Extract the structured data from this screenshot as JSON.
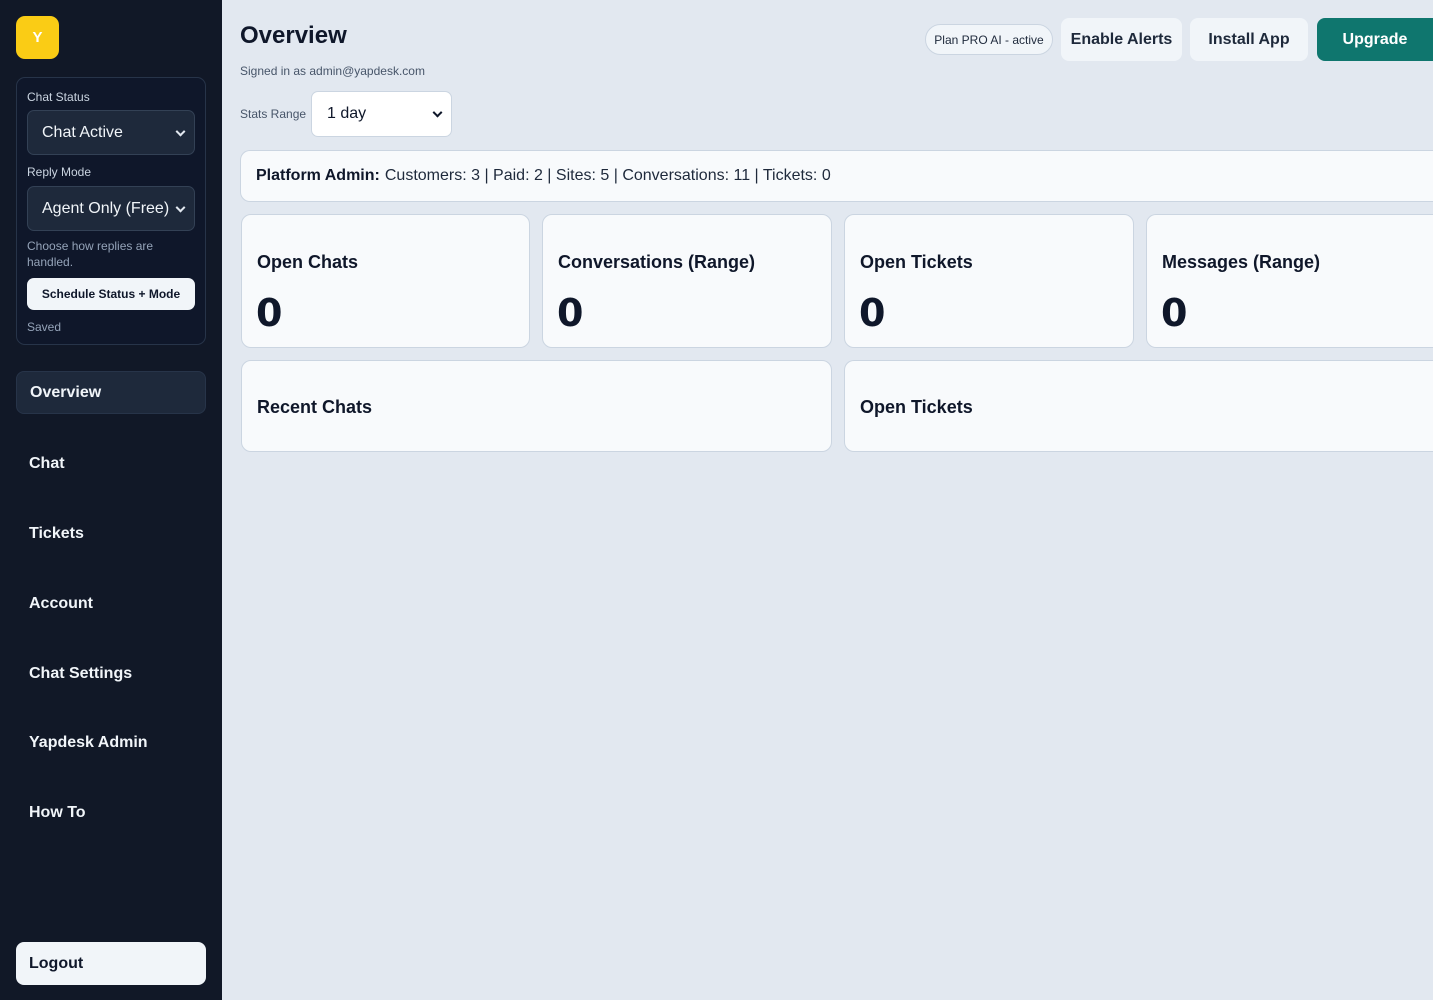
{
  "sidebar": {
    "logo_letter": "Y",
    "chat_status": {
      "label": "Chat Status",
      "selected": "Chat Active"
    },
    "reply_mode": {
      "label": "Reply Mode",
      "selected": "Agent Only (Free)",
      "help": "Choose how replies are handled."
    },
    "schedule_button": "Schedule Status + Mode",
    "saved_text": "Saved",
    "nav": [
      {
        "label": "Overview",
        "active": true
      },
      {
        "label": "Chat",
        "active": false
      },
      {
        "label": "Tickets",
        "active": false
      },
      {
        "label": "Account",
        "active": false
      },
      {
        "label": "Chat Settings",
        "active": false
      },
      {
        "label": "Yapdesk Admin",
        "active": false
      },
      {
        "label": "How To",
        "active": false
      }
    ],
    "logout": "Logout"
  },
  "header": {
    "title": "Overview",
    "signed_in": "Signed in as admin@yapdesk.com",
    "stats_range_label": "Stats Range",
    "stats_range_selected": "1 day",
    "plan_badge": "Plan PRO AI - active",
    "buttons": {
      "enable_alerts": "Enable Alerts",
      "install_app": "Install App",
      "upgrade": "Upgrade"
    }
  },
  "admin_bar": {
    "label": "Platform Admin:",
    "text": "Customers: 3 | Paid: 2 | Sites: 5 | Conversations: 11 | Tickets: 0"
  },
  "stats": [
    {
      "title": "Open Chats",
      "value": "0"
    },
    {
      "title": "Conversations (Range)",
      "value": "0"
    },
    {
      "title": "Open Tickets",
      "value": "0"
    },
    {
      "title": "Messages (Range)",
      "value": "0"
    }
  ],
  "panels": {
    "recent_chats": "Recent Chats",
    "open_tickets": "Open Tickets"
  },
  "colors": {
    "sidebar_bg": "#111827",
    "page_bg": "#e2e8f0",
    "accent": "#0f766e",
    "logo": "#facc15"
  }
}
